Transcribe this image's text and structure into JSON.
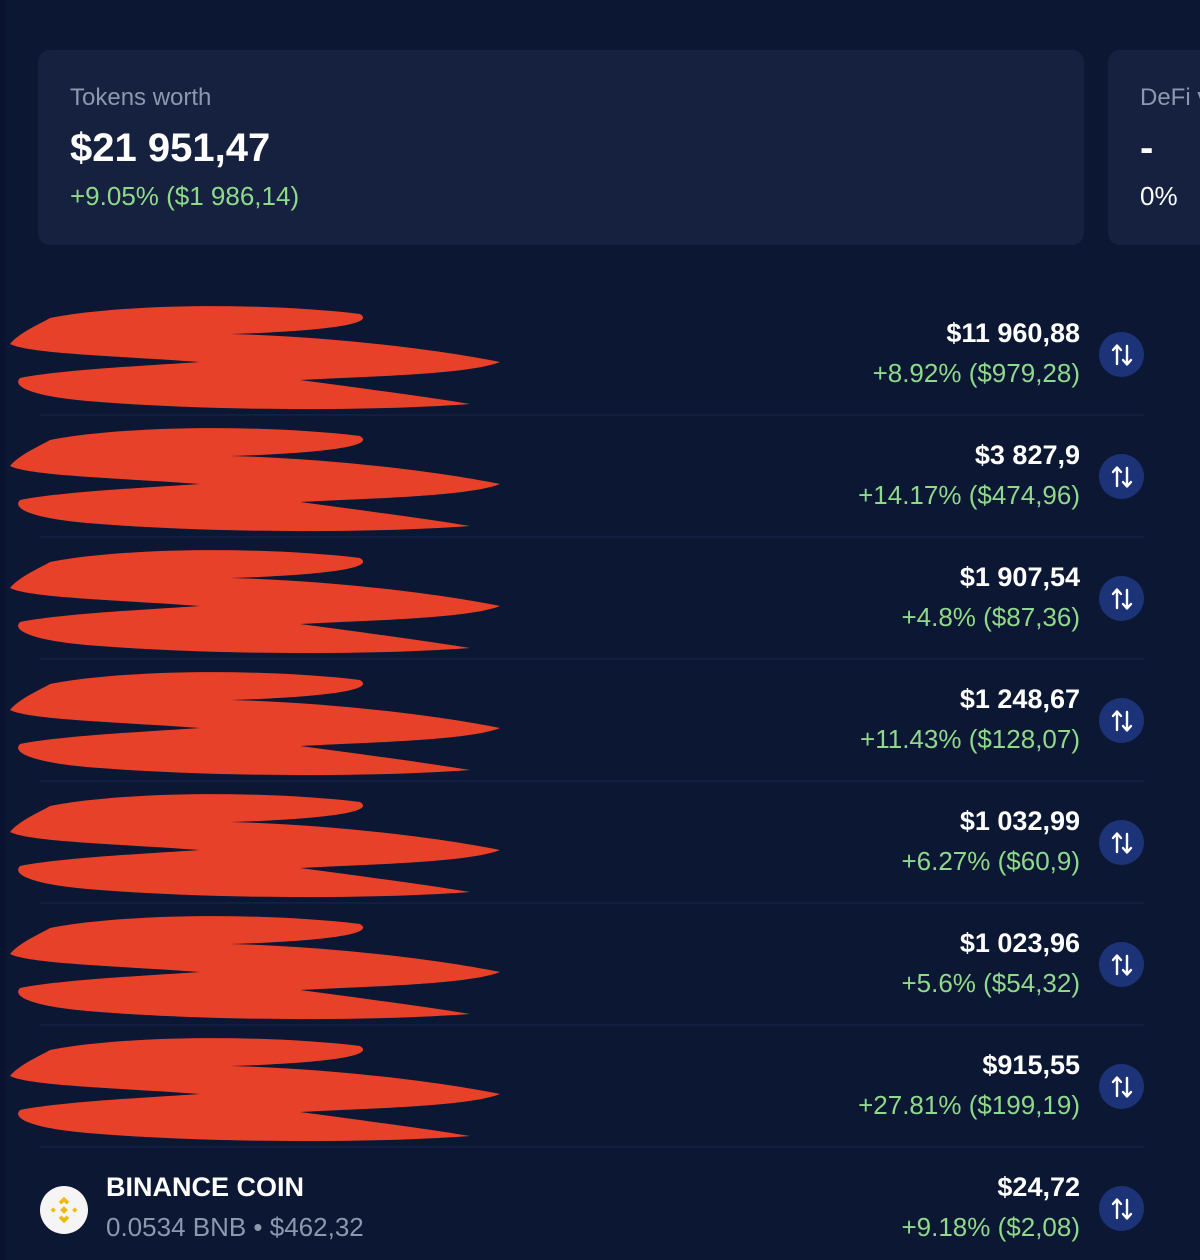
{
  "summary": {
    "tokens": {
      "label": "Tokens worth",
      "value": "$21 951,47",
      "change": "+9.05% ($1 986,14)"
    },
    "defi": {
      "label": "DeFi v",
      "value": "-",
      "change": "0%"
    }
  },
  "tokens": [
    {
      "value": "$11 960,88",
      "change": "+8.92% ($979,28)",
      "redacted": true
    },
    {
      "value": "$3 827,9",
      "change": "+14.17% ($474,96)",
      "redacted": true
    },
    {
      "value": "$1 907,54",
      "change": "+4.8% ($87,36)",
      "redacted": true
    },
    {
      "value": "$1 248,67",
      "change": "+11.43% ($128,07)",
      "redacted": true
    },
    {
      "value": "$1 032,99",
      "change": "+6.27% ($60,9)",
      "redacted": true
    },
    {
      "value": "$1 023,96",
      "change": "+5.6% ($54,32)",
      "redacted": true
    },
    {
      "value": "$915,55",
      "change": "+27.81% ($199,19)",
      "redacted": true
    },
    {
      "name": "BINANCE COIN",
      "sub": "0.0534 BNB • $462,32",
      "value": "$24,72",
      "change": "+9.18% ($2,08)",
      "icon": "binance-coin-icon",
      "redacted": false
    }
  ],
  "colors": {
    "background": "#0c1733",
    "card": "#16213f",
    "positive": "#8fd98a",
    "muted": "#8d97ad",
    "swap_button": "#1d3378",
    "redaction": "#e8412a",
    "binance": "#f0b90b"
  },
  "icons": {
    "swap": "swap-arrows-icon"
  }
}
